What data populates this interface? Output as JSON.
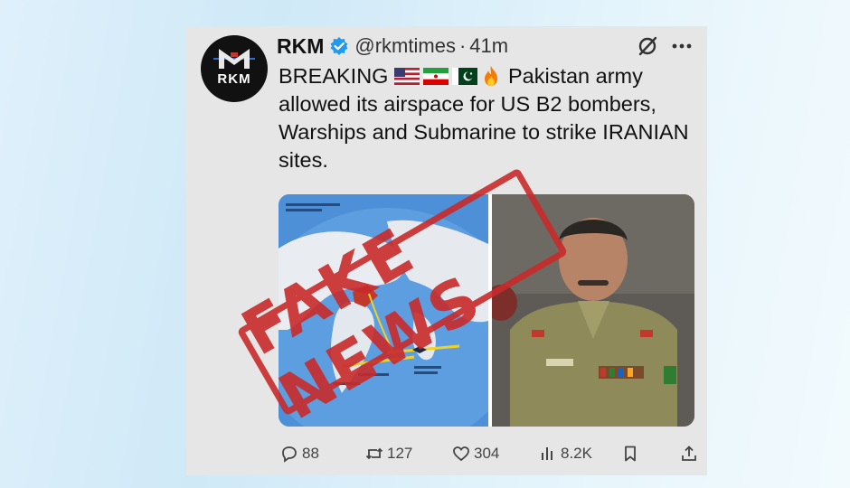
{
  "tweet": {
    "avatar_text": "RKM",
    "author_name": "RKM",
    "handle": "@rkmtimes",
    "separator": "·",
    "time": "41m",
    "breaking_label": "BREAKING",
    "flags": [
      "us-flag-icon",
      "iran-flag-icon",
      "pakistan-flag-icon",
      "fire-icon"
    ],
    "body": "Pakistan army allowed its airspace for US B2 bombers, Warships and Submarine to strike IRANIAN sites.",
    "verified_color": "#1d9bf0"
  },
  "media": {
    "stamp_text": "FAKE NEWS",
    "stamp_color": "#c92a2a"
  },
  "actions": {
    "replies": "88",
    "reposts": "127",
    "likes": "304",
    "views": "8.2K"
  }
}
